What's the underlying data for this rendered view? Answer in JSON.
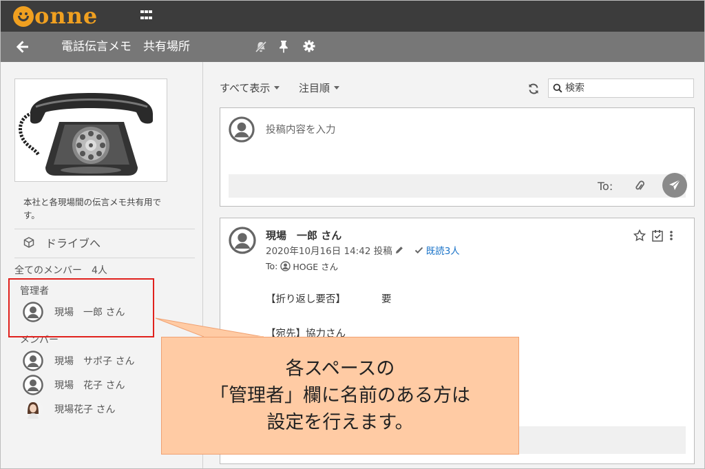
{
  "app": {
    "logo_rest": "onne",
    "brand_color": "#f0a020",
    "apps_icon": "grid-icon"
  },
  "header": {
    "space_title": "電話伝言メモ　共有場所",
    "icons": [
      "back-arrow-icon",
      "mute-bell-icon",
      "pin-icon",
      "gear-icon"
    ]
  },
  "sidebar": {
    "description": "本社と各現場間の伝言メモ共有用です。",
    "drive_label": "ドライブへ",
    "members_count": "全てのメンバー　4人",
    "admin_label": "管理者",
    "admins": [
      {
        "name": "現場　一郎 さん",
        "avatar": "default-avatar-icon"
      }
    ],
    "member_label": "メンバー",
    "members": [
      {
        "name": "現場　サポ子 さん",
        "avatar": "default-avatar-icon"
      },
      {
        "name": "現場　花子 さん",
        "avatar": "default-avatar-icon"
      },
      {
        "name": "現場花子 さん",
        "avatar": "photo-avatar"
      }
    ]
  },
  "main": {
    "filter_all": "すべて表示",
    "filter_sort": "注目順",
    "search_placeholder": "検索",
    "composer": {
      "placeholder": "投稿内容を入力",
      "to_label": "To:"
    },
    "post": {
      "author": "現場　一郎 さん",
      "timestamp": "2020年10月16日 14:42 投稿",
      "read_status": "既読3人",
      "to_label": "To:",
      "to_user": "HOGE さん",
      "line1_key": "【折り返し要否】",
      "line1_value": "要",
      "line2": "【宛先】協力さん"
    }
  },
  "callout": {
    "line1": "各スペースの",
    "line2": "「管理者」欄に名前のある方は",
    "line3": "設定を行えます。",
    "fill_color": "#ffcba4",
    "highlight_color": "#e0201c"
  }
}
